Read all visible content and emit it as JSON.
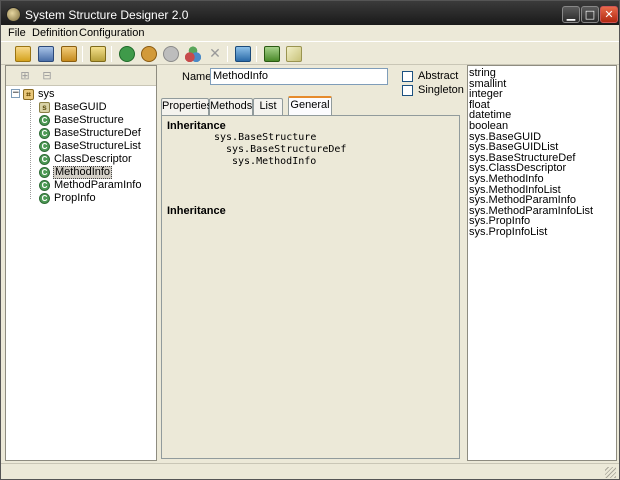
{
  "window": {
    "title": "System Structure Designer 2.0",
    "min_glyph": "▁",
    "max_glyph": "□",
    "close_glyph": "✕"
  },
  "menu": [
    "File",
    "Definition",
    "Configuration"
  ],
  "toolbar": {
    "icons": [
      "open-icon",
      "save-icon",
      "save-all-icon",
      "import-icon",
      "new-class-icon",
      "new-enum-icon",
      "new-interface-icon",
      "add-member-icon",
      "delete-icon",
      "publish-icon",
      "settings-icon",
      "edit-icon"
    ]
  },
  "left_tools": {
    "expand_glyph": "⊞",
    "collapse_glyph": "⊟"
  },
  "tree": {
    "expander": "−",
    "root": {
      "label": "sys",
      "icon": "namespace-icon",
      "glyph": "⌗"
    },
    "items": [
      {
        "label": "BaseGUID",
        "icon": "struct-icon",
        "glyph": "s"
      },
      {
        "label": "BaseStructure",
        "icon": "class-icon",
        "glyph": "C"
      },
      {
        "label": "BaseStructureDef",
        "icon": "class-icon",
        "glyph": "C"
      },
      {
        "label": "BaseStructureList",
        "icon": "class-icon",
        "glyph": "C"
      },
      {
        "label": "ClassDescriptor",
        "icon": "class-icon",
        "glyph": "C"
      },
      {
        "label": "MethodInfo",
        "icon": "class-icon",
        "glyph": "C"
      },
      {
        "label": "MethodParamInfo",
        "icon": "class-icon",
        "glyph": "C"
      },
      {
        "label": "PropInfo",
        "icon": "class-icon",
        "glyph": "C"
      }
    ],
    "selected": "MethodInfo"
  },
  "editor": {
    "name_label": "Name",
    "name_value": "MethodInfo",
    "abstract_label": "Abstract",
    "singleton_label": "Singleton",
    "tabs": [
      "Properties",
      "Methods",
      "List",
      "General"
    ],
    "active_tab": "General",
    "inheritance_title": "Inheritance",
    "inheritance_chain": [
      "sys.BaseStructure",
      "sys.BaseStructureDef",
      "sys.MethodInfo"
    ],
    "inheritance_title_2": "Inheritance"
  },
  "types": [
    "string",
    "smallint",
    "integer",
    "float",
    "datetime",
    "boolean",
    "sys.BaseGUID",
    "sys.BaseGUIDList",
    "sys.BaseStructureDef",
    "sys.ClassDescriptor",
    "sys.MethodInfo",
    "sys.MethodInfoList",
    "sys.MethodParamInfo",
    "sys.MethodParamInfoList",
    "sys.PropInfo",
    "sys.PropInfoList"
  ]
}
